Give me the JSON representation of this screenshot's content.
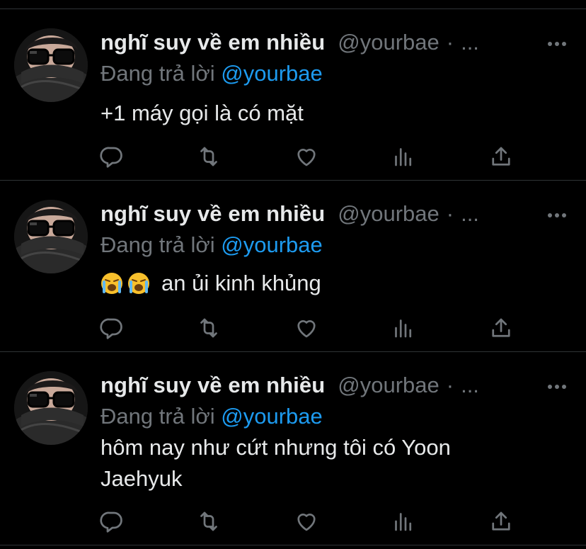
{
  "tweets": [
    {
      "display_name": "nghĩ suy về em nhiều",
      "handle": "@yourbae",
      "separator": "·",
      "time": "...",
      "reply_prefix": "Đang trả lời",
      "reply_to": "@yourbae",
      "text": "+1 máy gọi là có mặt"
    },
    {
      "display_name": "nghĩ suy về em nhiều",
      "handle": "@yourbae",
      "separator": "·",
      "time": "...",
      "reply_prefix": "Đang trả lời",
      "reply_to": "@yourbae",
      "text": "an ủi kinh khủng",
      "emojis": [
        "loudly-crying-face",
        "loudly-crying-face"
      ]
    },
    {
      "display_name": "nghĩ suy về em nhiều",
      "handle": "@yourbae",
      "separator": "·",
      "time": "...",
      "reply_prefix": "Đang trả lời",
      "reply_to": "@yourbae",
      "text_line1": "hôm nay như cứt nhưng tôi có Yoon",
      "text_line2": "Jaehyuk"
    }
  ],
  "icons": [
    "reply-icon",
    "retweet-icon",
    "like-icon",
    "analytics-icon",
    "share-icon",
    "more-options-icon"
  ],
  "colors": {
    "background": "#000000",
    "text": "#e7e9ea",
    "secondary": "#71767b",
    "link": "#1d9bf0",
    "divider": "#2f3336"
  }
}
